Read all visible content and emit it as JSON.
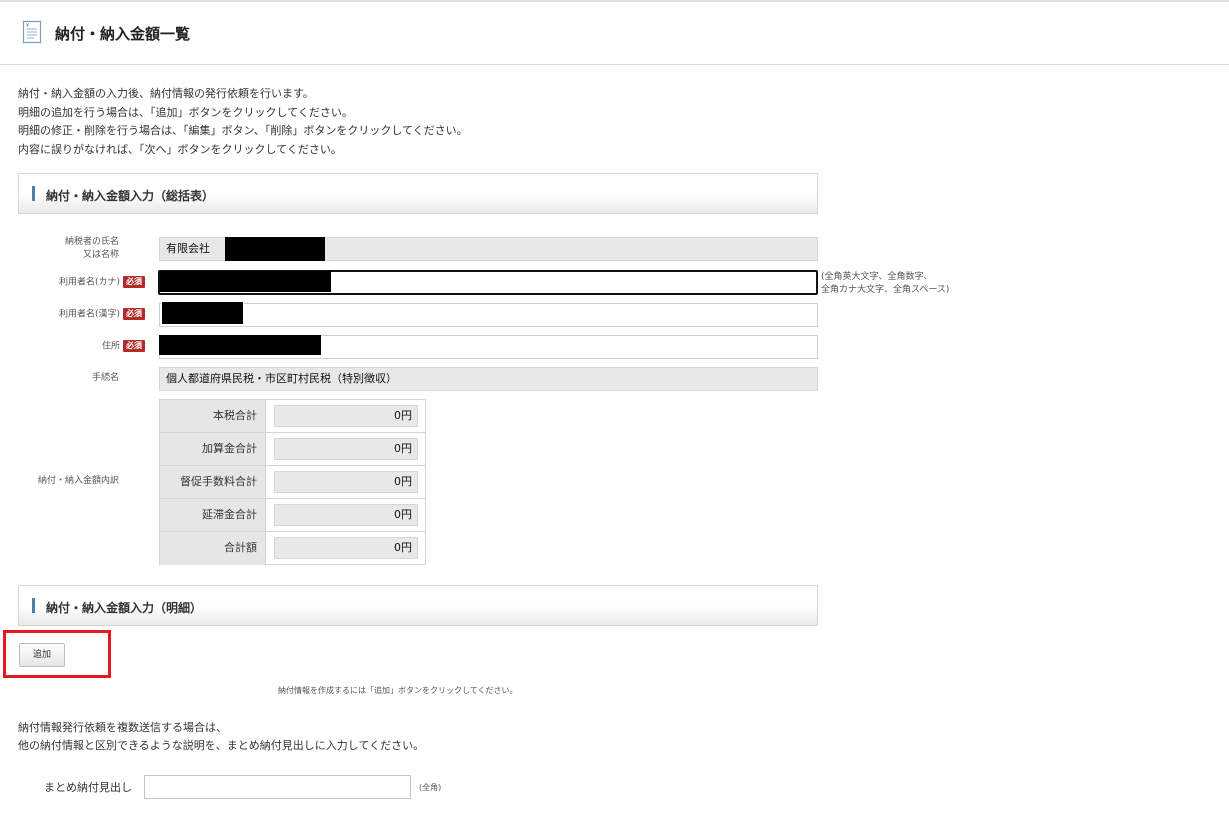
{
  "page": {
    "title": "納付・納入金額一覧",
    "icon": "document-icon"
  },
  "intro": [
    "納付・納入金額の入力後、納付情報の発行依頼を行います。",
    "明細の追加を行う場合は、「追加」ボタンをクリックしてください。",
    "明細の修正・削除を行う場合は、「編集」ボタン、「削除」ボタンをクリックしてください。",
    "内容に誤りがなければ、「次へ」ボタンをクリックしてください。"
  ],
  "summary_section": {
    "title": "納付・納入金額入力（総括表）",
    "required_badge": "必須",
    "taxpayer_name": {
      "label_line1": "納税者の氏名",
      "label_line2": "又は名称",
      "value": "有限会社"
    },
    "user_kana": {
      "label": "利用者名(カナ)",
      "note_line1": "(全角英大文字、全角数字、",
      "note_line2": "全角カナ大文字、全角スペース)"
    },
    "user_kanji": {
      "label": "利用者名(漢字)"
    },
    "address": {
      "label": "住所"
    },
    "procedure": {
      "label": "手続名",
      "value": "個人都道府県民税・市区町村民税（特別徴収）"
    },
    "breakdown": {
      "label": "納付・納入金額内訳",
      "rows": [
        {
          "label": "本税合計",
          "value": "0円"
        },
        {
          "label": "加算金合計",
          "value": "0円"
        },
        {
          "label": "督促手数料合計",
          "value": "0円"
        },
        {
          "label": "延滞金合計",
          "value": "0円"
        },
        {
          "label": "合計額",
          "value": "0円"
        }
      ]
    }
  },
  "detail_section": {
    "title": "納付・納入金額入力（明細）",
    "add_button": "追加",
    "add_hint": "納付情報を作成するには「追加」ボタンをクリックしてください。"
  },
  "multi_send": {
    "line1": "納付情報発行依頼を複数送信する場合は、",
    "line2": "他の納付情報と区別できるような説明を、まとめ納付見出しに入力してください。",
    "heading_label": "まとめ納付見出し",
    "heading_note": "(全角)"
  },
  "colors": {
    "section_accent": "#4f7fa6",
    "required_badge": "#b22a2a",
    "highlight_box": "#e3191f"
  }
}
